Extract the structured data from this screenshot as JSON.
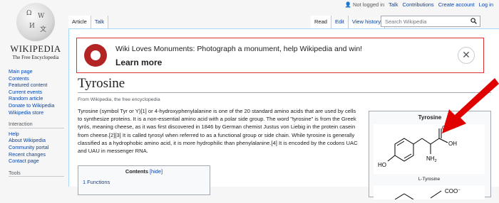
{
  "personal_tools": {
    "not_logged_in": "Not logged in",
    "items": [
      "Talk",
      "Contributions",
      "Create account",
      "Log in"
    ]
  },
  "logo": {
    "wordmark": "WIKIPEDIA",
    "tagline": "The Free Encyclopedia"
  },
  "sidebar": {
    "main": [
      "Main page",
      "Contents",
      "Featured content",
      "Current events",
      "Random article",
      "Donate to Wikipedia",
      "Wikipedia store"
    ],
    "interaction_heading": "Interaction",
    "interaction": [
      "Help",
      "About Wikipedia",
      "Community portal",
      "Recent changes",
      "Contact page"
    ],
    "tools_heading": "Tools"
  },
  "tabs": {
    "left": [
      "Article",
      "Talk"
    ],
    "right": [
      "Read",
      "Edit",
      "View history"
    ]
  },
  "search": {
    "placeholder": "Search Wikipedia"
  },
  "banner": {
    "message": "Wiki Loves Monuments: Photograph a monument, help Wikipedia and win!",
    "cta": "Learn more"
  },
  "article": {
    "title": "Tyrosine",
    "from": "From Wikipedia, the free encyclopedia",
    "para": [
      "Tyrosine (symbol Tyr or Y)[1] or 4-hydroxyphenylalanine is one of the 20 standard amino acids that are used by cells",
      "to synthesize proteins. It is a non-essential amino acid with a polar side group. The word \"tyrosine\" is from the Greek",
      "tyrós, meaning cheese, as it was first discovered in 1846 by German chemist Justus von Liebig in the protein casein",
      "from cheese.[2][3] It is called tyrosyl when referred to as a functional group or side chain. While tyrosine is generally",
      "classified as a hydrophobic amino acid, it is more hydrophilic than phenylalanine.[4] It is encoded by the codons UAC",
      "and UAU in messenger RNA."
    ]
  },
  "toc": {
    "title": "Contents",
    "hide": "[hide]",
    "items": [
      "1 Functions"
    ]
  },
  "infobox": {
    "title": "Tyrosine",
    "caption": "L-Tyrosine",
    "labels": {
      "oh": "OH",
      "ho": "HO",
      "nh2": "NH",
      "nh2_sub": "2",
      "o": "O",
      "coo": "COO",
      "coo_sup": "−"
    }
  },
  "colors": {
    "link": "#0645ad",
    "banner_border": "#dd3333",
    "arrow": "#e00000"
  }
}
